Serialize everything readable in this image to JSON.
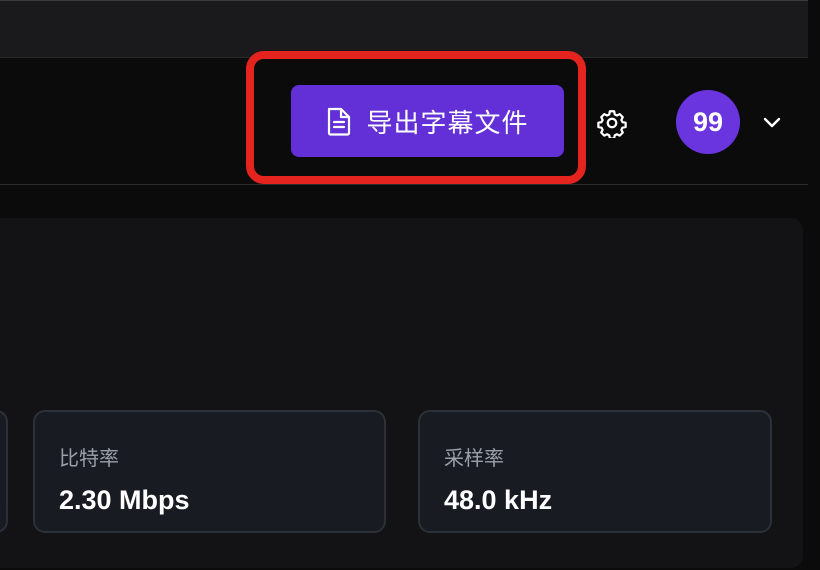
{
  "header": {
    "export_button": {
      "label": "导出字幕文件",
      "icon": "document-icon",
      "color": "#6230d6"
    },
    "settings_icon": "gear-icon",
    "avatar": {
      "text": "99",
      "color": "#6a35df"
    },
    "menu_icon": "chevron-down-icon"
  },
  "highlight": {
    "color": "#e5241f"
  },
  "stats": [
    {
      "label": "比特率",
      "value": "2.30 Mbps"
    },
    {
      "label": "采样率",
      "value": "48.0 kHz"
    }
  ]
}
